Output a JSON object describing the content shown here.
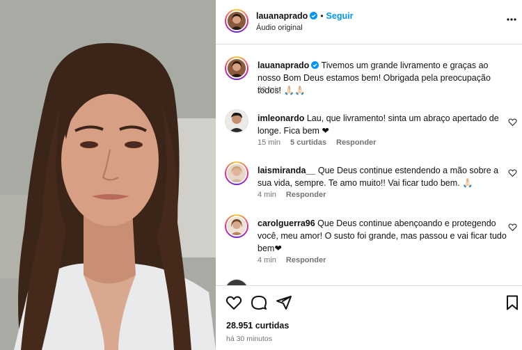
{
  "post": {
    "author": "lauanaprado",
    "follow_label": "Seguir",
    "audio": "Áudio original"
  },
  "caption": {
    "username": "lauanaprado",
    "text": " Tivemos um grande livramento e graças ao nosso Bom Deus estamos bem! Obrigada pela preocupação todos! 🙏🏻🙏🏻",
    "time": "30 min"
  },
  "comments": [
    {
      "username": "imleonardo",
      "text": " Lau, que livramento! sinta um abraço apertado de longe. Fica bem ❤",
      "time": "15 min",
      "likes": "5 curtidas",
      "reply": "Responder"
    },
    {
      "username": "laismiranda__",
      "text": " Que Deus continue estendendo a mão sobre a sua vida, sempre. Te amo muito!! Vai ficar tudo bem. 🙏🏻",
      "time": "4 min",
      "reply": "Responder"
    },
    {
      "username": "carolguerra96",
      "text": " Que Deus continue abençoando e protegendo você, meu amor! O susto foi grande, mas passou e vai ficar tudo bem❤",
      "time": "4 min",
      "reply": "Responder"
    }
  ],
  "footer": {
    "likes": "28.951 curtidas",
    "time": "há 30 minutos"
  },
  "colors": {
    "accent": "#0095f6",
    "verified": "#0095f6",
    "muted": "#737373"
  }
}
